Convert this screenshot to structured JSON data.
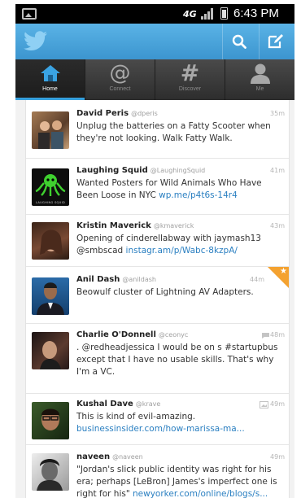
{
  "status_bar": {
    "network": "4G",
    "time": "6:43 PM"
  },
  "action_bar": {
    "logo": "twitter-bird-icon",
    "actions": [
      "search-icon",
      "compose-icon"
    ]
  },
  "tabs": [
    {
      "label": "Home",
      "icon": "home-icon",
      "active": true
    },
    {
      "label": "Connect",
      "icon": "at-icon",
      "active": false
    },
    {
      "label": "Discover",
      "icon": "hash-icon",
      "active": false
    },
    {
      "label": "Me",
      "icon": "person-icon",
      "active": false
    }
  ],
  "tweets": [
    {
      "name": "David Peris",
      "handle": "@dperis",
      "time": "35m",
      "text": "Unplug the batteries on a Fatty Scooter when they're not looking.  Walk Fatty Walk.",
      "link": ""
    },
    {
      "name": "Laughing Squid",
      "handle": "@LaughingSquid",
      "time": "41m",
      "text": "Wanted Posters for Wild Animals Who Have Been Loose in NYC ",
      "link": "wp.me/p4t6s-14r4",
      "avatar_caption": "LAUGHING SQUID"
    },
    {
      "name": "Kristin Maverick",
      "handle": "@kmaverick",
      "time": "43m",
      "text": "Opening of cinderellabway with jaymash13 @smbscad ",
      "link": "instagr.am/p/Wabc-8kzpA/"
    },
    {
      "name": "Anil Dash",
      "handle": "@anildash",
      "time": "44m",
      "text": "Beowulf cluster of Lightning AV Adapters.",
      "link": "",
      "favorited": true
    },
    {
      "name": "Charlie O'Donnell",
      "handle": "@ceonyc",
      "time": "48m",
      "text": ". @redheadjessica I would be on s #startupbus except that I have no usable skills.  That's why I'm a VC.",
      "link": "",
      "meta_icon": "speech-bubble-icon"
    },
    {
      "name": "Kushal Dave",
      "handle": "@krave",
      "time": "49m",
      "text": "This is kind of evil-amazing. ",
      "link": "businessinsider.com/how-marissa-ma...",
      "meta_icon": "image-icon"
    },
    {
      "name": "naveen",
      "handle": "@naveen",
      "time": "49m",
      "text": "\"Jordan's slick public identity was right for his era; perhaps [LeBron] James's imperfect one is right for his\" ",
      "link": "newyorker.com/online/blogs/s..."
    }
  ],
  "colors": {
    "brand": "#3c95cf",
    "link": "#2a7fc1",
    "fav": "#f4a230"
  }
}
